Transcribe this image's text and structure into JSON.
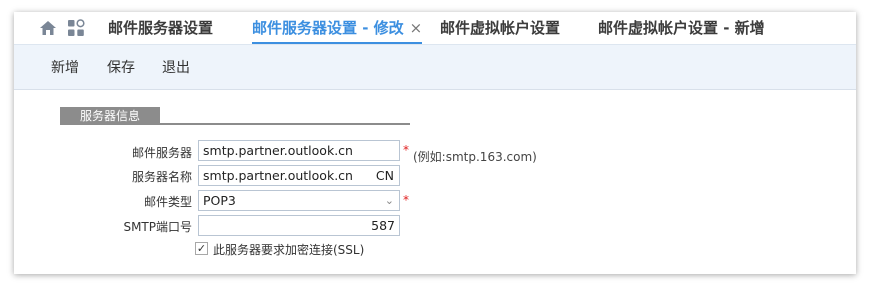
{
  "tabs": [
    {
      "label": "邮件服务器设置"
    },
    {
      "label": "邮件服务器设置 - 修改",
      "close": "×"
    },
    {
      "label": "邮件虚拟帐户设置"
    },
    {
      "label": "邮件虚拟帐户设置 - 新增"
    }
  ],
  "toolbar": {
    "new_label": "新增",
    "save_label": "保存",
    "exit_label": "退出"
  },
  "section": {
    "title": "服务器信息"
  },
  "form": {
    "mail_server": {
      "label": "邮件服务器",
      "value": "smtp.partner.outlook.cn",
      "required": "*",
      "hint": "(例如:smtp.163.com)"
    },
    "server_name": {
      "label": "服务器名称",
      "value": "smtp.partner.outlook.cn",
      "suffix": "CN"
    },
    "mail_type": {
      "label": "邮件类型",
      "value": "POP3",
      "required": "*"
    },
    "smtp_port": {
      "label": "SMTP端口号",
      "value": "587"
    },
    "ssl": {
      "label": "此服务器要求加密连接(SSL)",
      "checked": true
    }
  },
  "colors": {
    "accent": "#3c8fe0",
    "toolbar_bg": "#eef4fb",
    "section_bg": "#8c8c8c",
    "required": "#e02020"
  }
}
